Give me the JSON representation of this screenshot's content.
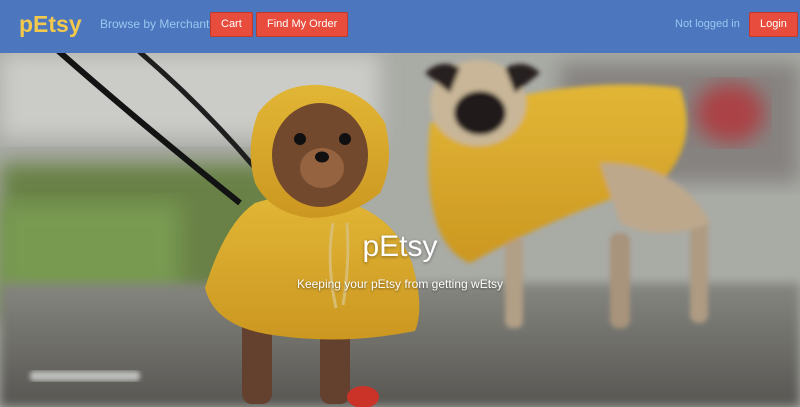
{
  "navbar": {
    "brand": "pEtsy",
    "browse_label": "Browse by Merchant",
    "cart_label": "Cart",
    "find_order_label": "Find My Order",
    "status_text": "Not logged in",
    "login_label": "Login"
  },
  "hero": {
    "title": "pEtsy",
    "subtitle": "Keeping your pEtsy from getting wEtsy",
    "image_subject": "small dog and pug wearing yellow raincoats on a wet sidewalk"
  },
  "colors": {
    "navbar_bg": "#4c76be",
    "brand": "#f2c94c",
    "link": "#9cc7ef",
    "button_bg": "#e74c3c",
    "raincoat": "#e6b32c"
  }
}
